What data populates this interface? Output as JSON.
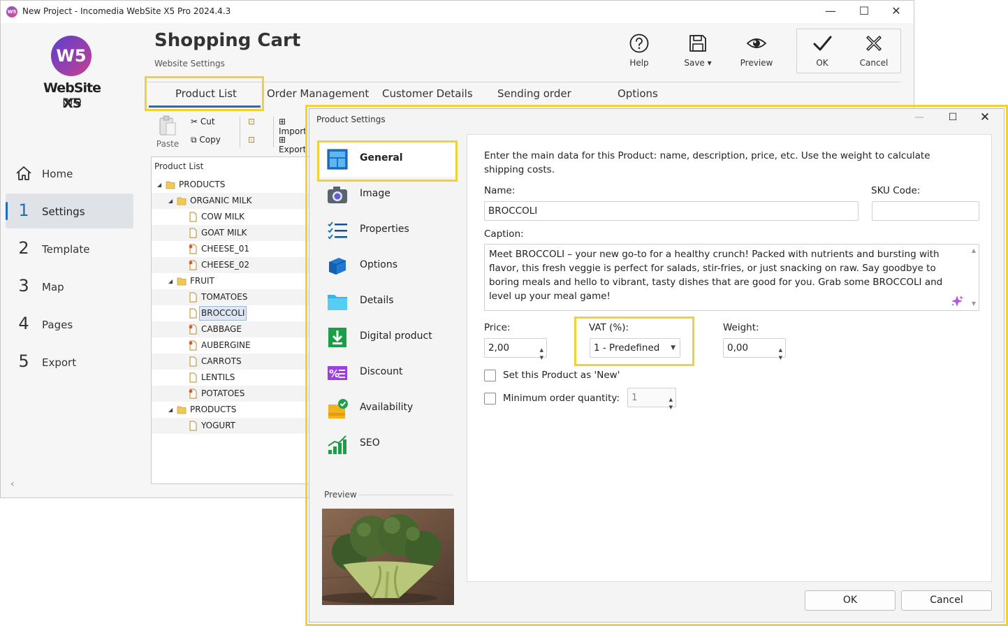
{
  "window": {
    "title": "New Project - Incomedia WebSite X5 Pro 2024.4.3",
    "minimize": "—",
    "maximize": "☐",
    "close": "✕"
  },
  "logo": {
    "badge": "W5",
    "wordmark": "WebSite X5",
    "edition": "pro"
  },
  "nav": {
    "items": [
      {
        "num": "",
        "label": "Home",
        "icon": "home-icon"
      },
      {
        "num": "1",
        "label": "Settings",
        "active": true
      },
      {
        "num": "2",
        "label": "Template"
      },
      {
        "num": "3",
        "label": "Map"
      },
      {
        "num": "4",
        "label": "Pages"
      },
      {
        "num": "5",
        "label": "Export"
      }
    ],
    "collapse": "‹"
  },
  "header": {
    "title": "Shopping Cart",
    "subtitle": "Website Settings"
  },
  "toolbar": {
    "help": "Help",
    "save": "Save ▾",
    "preview": "Preview",
    "ok": "OK",
    "cancel": "Cancel"
  },
  "tabs": [
    "Product List",
    "Order Management",
    "Customer Details",
    "Sending order",
    "Options"
  ],
  "ribbon": {
    "paste": "Paste",
    "cut": "Cut",
    "copy": "Copy",
    "import": "Import",
    "export": "Export"
  },
  "product_list": {
    "header": "Product List",
    "rows": [
      {
        "label": "PRODUCTS",
        "level": 0,
        "type": "folder",
        "expanded": true
      },
      {
        "label": "ORGANIC MILK",
        "level": 1,
        "type": "folder",
        "expanded": true
      },
      {
        "label": "COW MILK",
        "level": 2,
        "type": "item"
      },
      {
        "label": "GOAT MILK",
        "level": 2,
        "type": "item"
      },
      {
        "label": "CHEESE_01",
        "level": 2,
        "type": "item-variant"
      },
      {
        "label": "CHEESE_02",
        "level": 2,
        "type": "item-variant"
      },
      {
        "label": "FRUIT",
        "level": 1,
        "type": "folder",
        "expanded": true
      },
      {
        "label": "TOMATOES",
        "level": 2,
        "type": "item"
      },
      {
        "label": "BROCCOLI",
        "level": 2,
        "type": "item",
        "selected": true
      },
      {
        "label": "CABBAGE",
        "level": 2,
        "type": "item-variant"
      },
      {
        "label": "AUBERGINE",
        "level": 2,
        "type": "item-variant"
      },
      {
        "label": "CARROTS",
        "level": 2,
        "type": "item"
      },
      {
        "label": "LENTILS",
        "level": 2,
        "type": "item"
      },
      {
        "label": "POTATOES",
        "level": 2,
        "type": "item-variant"
      },
      {
        "label": "PRODUCTS",
        "level": 1,
        "type": "folder",
        "expanded": true
      },
      {
        "label": "YOGURT",
        "level": 2,
        "type": "item"
      }
    ]
  },
  "dialog": {
    "title": "Product Settings",
    "min": "—",
    "max": "☐",
    "close": "✕",
    "menu": [
      {
        "label": "General",
        "icon": "general-icon",
        "active": true
      },
      {
        "label": "Image",
        "icon": "camera-icon"
      },
      {
        "label": "Properties",
        "icon": "checklist-icon"
      },
      {
        "label": "Options",
        "icon": "cube-icon"
      },
      {
        "label": "Details",
        "icon": "folder-icon"
      },
      {
        "label": "Digital product",
        "icon": "download-icon"
      },
      {
        "label": "Discount",
        "icon": "percent-icon"
      },
      {
        "label": "Availability",
        "icon": "availability-icon"
      },
      {
        "label": "SEO",
        "icon": "seo-chart-icon"
      }
    ],
    "preview_label": "Preview",
    "intro": "Enter the main data for this Product: name, description, price, etc. Use the weight to calculate shipping costs.",
    "name_label": "Name:",
    "name_value": "BROCCOLI",
    "sku_label": "SKU Code:",
    "sku_value": "",
    "caption_label": "Caption:",
    "caption_value": "Meet BROCCOLI – your new go-to for a healthy crunch! Packed with nutrients and bursting with flavor, this fresh veggie is perfect for salads, stir-fries, or just snacking on raw. Say goodbye to boring meals and hello to vibrant, tasty dishes that are good for you. Grab some BROCCOLI and level up your meal game!",
    "price_label": "Price:",
    "price_value": "2,00",
    "vat_label": "VAT (%):",
    "vat_value": "1 - Predefined",
    "weight_label": "Weight:",
    "weight_value": "0,00",
    "new_label": "Set this Product as 'New'",
    "new_checked": false,
    "minqty_label": "Minimum order quantity:",
    "minqty_checked": false,
    "minqty_value": "1",
    "ok": "OK",
    "cancel": "Cancel"
  },
  "colors": {
    "accent": "#1e6fb8",
    "highlight": "#f2d233"
  }
}
